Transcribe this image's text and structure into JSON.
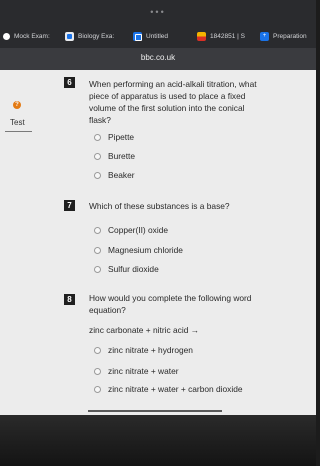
{
  "browser": {
    "menu_dots": "•••",
    "tabs": [
      {
        "label": "Mock Exam:",
        "icon": "dot-icon"
      },
      {
        "label": "Biology Exa:",
        "icon": "google-g-icon"
      },
      {
        "label": "Untitled",
        "icon": "docs-icon"
      },
      {
        "label": "1842851 | S",
        "icon": "grid-icon"
      },
      {
        "label": "Preparation",
        "icon": "plus-icon"
      }
    ],
    "url": "bbc.co.uk"
  },
  "sidebar": {
    "icon_glyph": "?",
    "label": "Test"
  },
  "questions": [
    {
      "number": "6",
      "text": "When performing an acid-alkali titration, what piece of apparatus is used to place a fixed volume of the first solution into the conical flask?",
      "options": [
        "Pipette",
        "Burette",
        "Beaker"
      ]
    },
    {
      "number": "7",
      "text": "Which of these substances is a base?",
      "options": [
        "Copper(II) oxide",
        "Magnesium chloride",
        "Sulfur dioxide"
      ]
    },
    {
      "number": "8",
      "text": "How would you complete the following word equation?",
      "equation": "zinc carbonate + nitric acid →",
      "options": [
        "zinc nitrate + hydrogen",
        "zinc nitrate + water",
        "zinc nitrate + water + carbon dioxide"
      ]
    }
  ],
  "colors": {
    "page_bg": "#ececec",
    "chrome_bg": "#2a2b2e",
    "number_badge": "#1f1f1f",
    "help_icon": "#e37a14"
  }
}
